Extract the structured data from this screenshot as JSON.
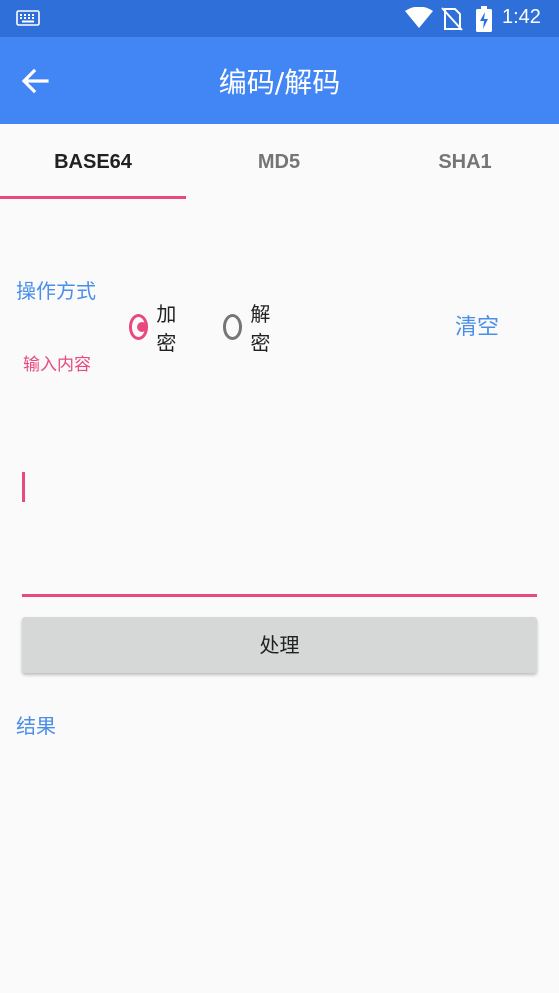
{
  "status_bar": {
    "time": "1:42",
    "icons": [
      "keyboard-icon",
      "wifi-icon",
      "no-sim-icon",
      "battery-charging-icon"
    ]
  },
  "app_bar": {
    "title": "编码/解码",
    "back_icon": "arrow-left-icon"
  },
  "tabs": [
    {
      "label": "BASE64",
      "active": true
    },
    {
      "label": "MD5",
      "active": false
    },
    {
      "label": "SHA1",
      "active": false
    }
  ],
  "operation": {
    "label": "操作方式",
    "options": [
      {
        "label": "加密",
        "checked": true
      },
      {
        "label": "解密",
        "checked": false
      }
    ],
    "clear_label": "清空"
  },
  "input": {
    "hint": "输入内容",
    "value": ""
  },
  "process_button": {
    "label": "处理"
  },
  "result": {
    "label": "结果",
    "value": ""
  },
  "colors": {
    "status_bar": "#2f6fd9",
    "app_bar": "#4285f4",
    "accent": "#e8497f",
    "link_blue": "#4a8ee8",
    "button_bg": "#d6d7d7",
    "background": "#fafafa"
  }
}
